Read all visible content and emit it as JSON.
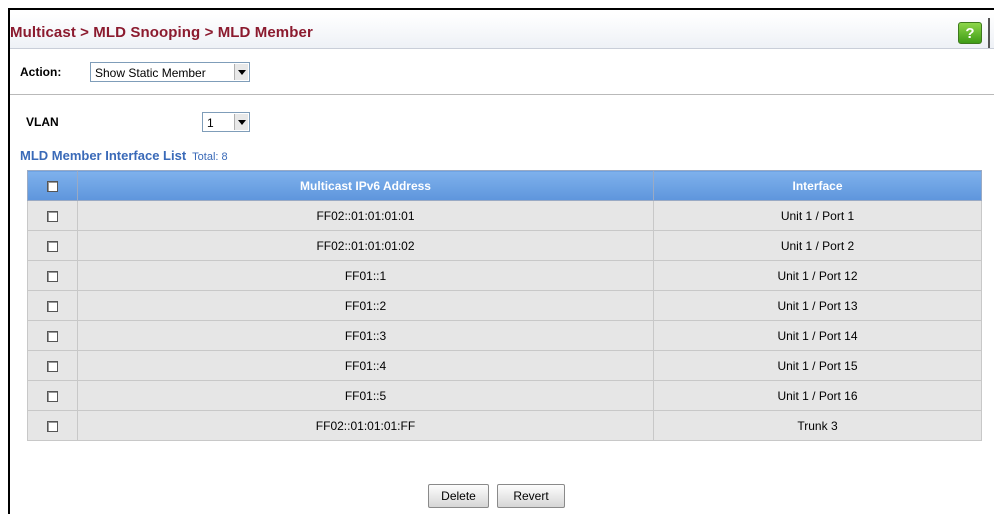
{
  "header": {
    "breadcrumb": "Multicast > MLD Snooping > MLD Member",
    "help_glyph": "?"
  },
  "action": {
    "label": "Action:",
    "selected": "Show Static Member"
  },
  "vlan": {
    "label": "VLAN",
    "selected": "1"
  },
  "list": {
    "title": "MLD Member Interface List",
    "total": "Total: 8",
    "columns": [
      "Multicast IPv6 Address",
      "Interface"
    ],
    "rows": [
      {
        "address": "FF02::01:01:01:01",
        "interface": "Unit 1 / Port 1"
      },
      {
        "address": "FF02::01:01:01:02",
        "interface": "Unit 1 / Port 2"
      },
      {
        "address": "FF01::1",
        "interface": "Unit 1 / Port 12"
      },
      {
        "address": "FF01::2",
        "interface": "Unit 1 / Port 13"
      },
      {
        "address": "FF01::3",
        "interface": "Unit 1 / Port 14"
      },
      {
        "address": "FF01::4",
        "interface": "Unit 1 / Port 15"
      },
      {
        "address": "FF01::5",
        "interface": "Unit 1 / Port 16"
      },
      {
        "address": "FF02::01:01:01:FF",
        "interface": "Trunk 3"
      }
    ]
  },
  "buttons": {
    "delete": "Delete",
    "revert": "Revert"
  },
  "colors": {
    "title": "#8b1a2e",
    "list_title": "#3a6ab8",
    "header_bg": "#6ea3e6",
    "row_bg": "#e6e6e6",
    "help_bg": "#5cb82a"
  }
}
